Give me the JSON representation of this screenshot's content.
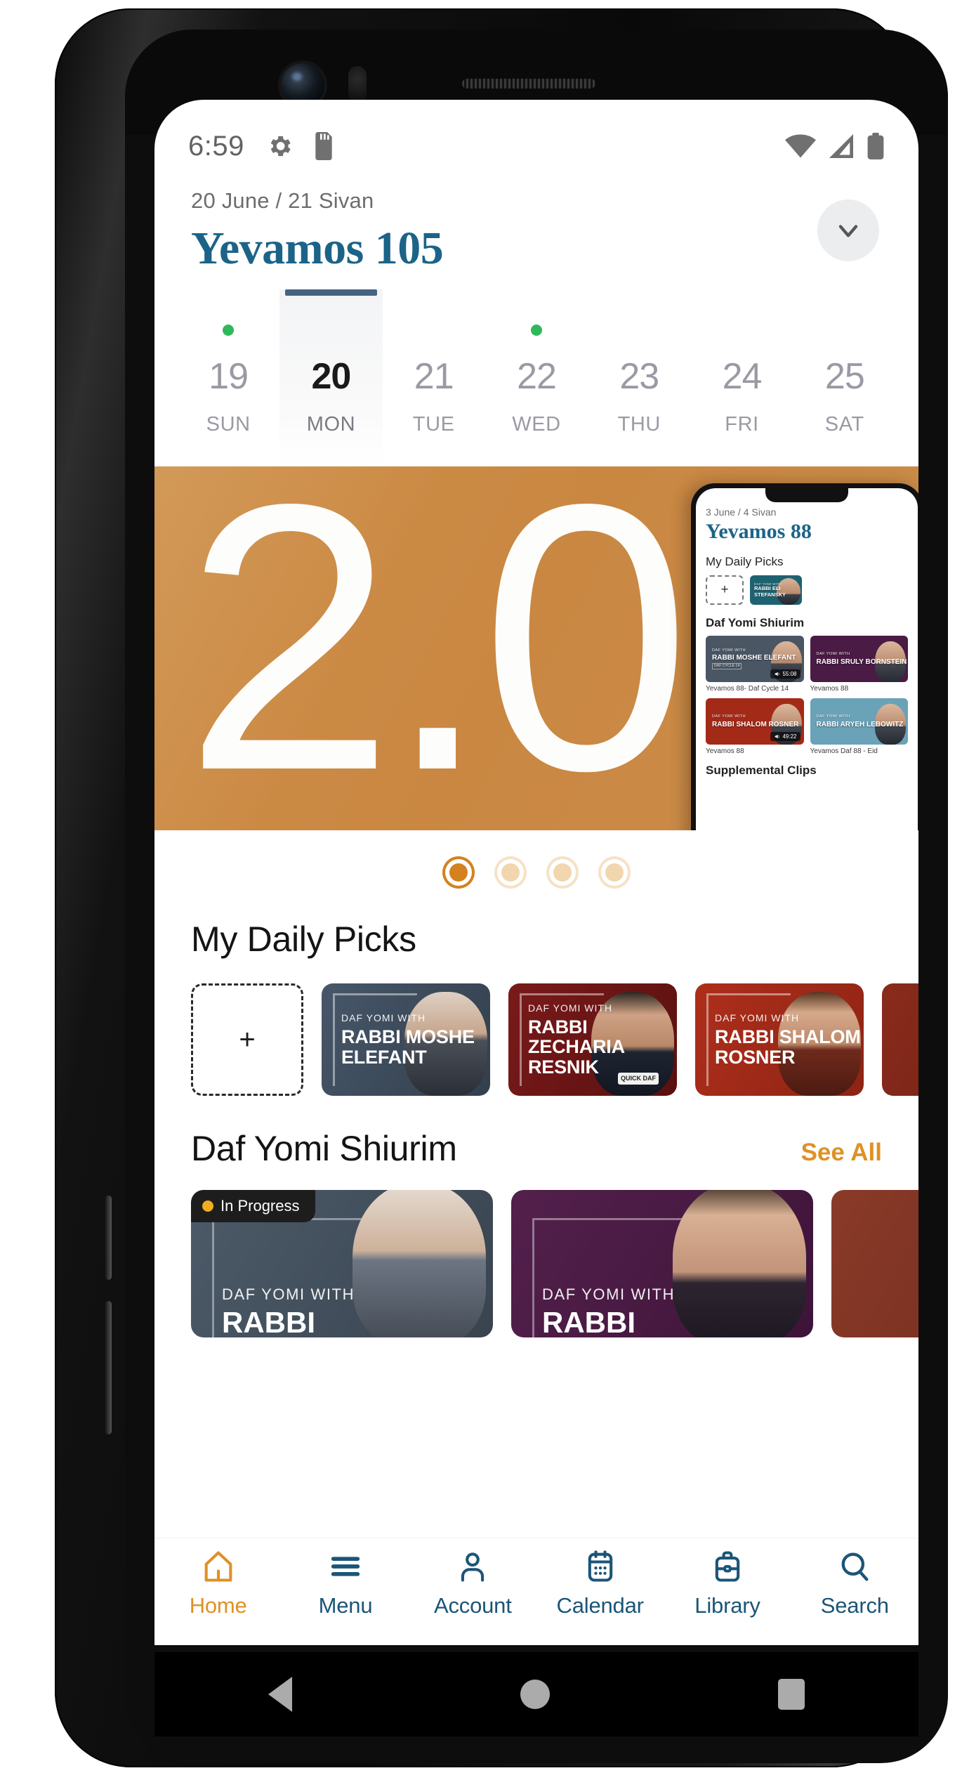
{
  "statusbar": {
    "time": "6:59",
    "left_icons": [
      "gear-icon",
      "sd-card-icon"
    ],
    "right_icons": [
      "wifi-icon",
      "cell-signal-icon",
      "battery-icon"
    ]
  },
  "header": {
    "date_line": "20 June / 21 Sivan",
    "title": "Yevamos 105",
    "expand_icon": "chevron-down-icon"
  },
  "date_strip": {
    "days": [
      {
        "num": "19",
        "name": "SUN",
        "selected": false,
        "dot": true
      },
      {
        "num": "20",
        "name": "MON",
        "selected": true,
        "dot": false
      },
      {
        "num": "21",
        "name": "TUE",
        "selected": false,
        "dot": false
      },
      {
        "num": "22",
        "name": "WED",
        "selected": false,
        "dot": true
      },
      {
        "num": "23",
        "name": "THU",
        "selected": false,
        "dot": false
      },
      {
        "num": "24",
        "name": "FRI",
        "selected": false,
        "dot": false
      },
      {
        "num": "25",
        "name": "SAT",
        "selected": false,
        "dot": false
      }
    ],
    "dot_color": "#2eb85c",
    "selected_bar_color": "#456382"
  },
  "promo": {
    "headline": "2.0",
    "background_color": "#cf9049",
    "inset_phone": {
      "date_line": "3 June / 4 Sivan",
      "title": "Yevamos 88",
      "picks_heading": "My Daily Picks",
      "picks": [
        {
          "label": "add",
          "glyph": "+"
        },
        {
          "prefix": "DAF YOMI WITH",
          "name": "RABBI ELI STEFANSKY",
          "color": "#1e6272"
        }
      ],
      "shiurim_heading": "Daf Yomi Shiurim",
      "shiurim": [
        {
          "prefix": "DAF YOMI WITH",
          "name": "RABBI MOSHE ELEFANT",
          "cycle": "DAF CYCLE 14",
          "duration": "55:08",
          "caption": "Yevamos 88- Daf Cycle 14",
          "color": "#4a5664"
        },
        {
          "prefix": "DAF YOMI WITH",
          "name": "RABBI SRULY BORNSTEIN",
          "cycle": "",
          "duration": "",
          "caption": "Yevamos 88",
          "color": "#4a1b44"
        },
        {
          "prefix": "DAF YOMI WITH",
          "name": "RABBI SHALOM ROSNER",
          "cycle": "",
          "duration": "49:22",
          "caption": "Yevamos 88",
          "color": "#a42a18"
        },
        {
          "prefix": "DAF YOMI WITH",
          "name": "RABBI ARYEH LEBOWITZ",
          "cycle": "",
          "duration": "",
          "caption": "Yevamos Daf 88 - Eid",
          "color": "#6aa2b8"
        }
      ],
      "supplemental_heading": "Supplemental Clips"
    }
  },
  "carousel": {
    "total": 4,
    "active_index": 0,
    "active_color": "#d4821f",
    "inactive_color": "#f3d9b5"
  },
  "daily_picks": {
    "heading": "My Daily Picks",
    "add_glyph": "+",
    "cards": [
      {
        "prefix": "DAF YOMI WITH",
        "name": "RABBI MOSHE ELEFANT",
        "color": "#3d4c5c",
        "badge": ""
      },
      {
        "prefix": "DAF YOMI WITH",
        "name": "RABBI ZECHARIA RESNIK",
        "color": "#6d1414",
        "badge": "QUICK DAF"
      },
      {
        "prefix": "DAF YOMI WITH",
        "name": "RABBI SHALOM ROSNER",
        "color": "#a42a18",
        "badge": ""
      },
      {
        "prefix": "",
        "name": "",
        "color": "#8a2b1c",
        "badge": ""
      }
    ]
  },
  "shiurim": {
    "heading": "Daf Yomi Shiurim",
    "see_all": "See All",
    "cards": [
      {
        "prefix": "DAF YOMI WITH",
        "name": "RABBI",
        "color": "#4a5664",
        "badge": "In Progress",
        "badge_dot_color": "#f0ad1e"
      },
      {
        "prefix": "DAF YOMI WITH",
        "name": "RABBI",
        "color": "#4a1b44",
        "badge": ""
      },
      {
        "prefix": "",
        "name": "",
        "color": "#8a3a28",
        "badge": ""
      }
    ]
  },
  "tabbar": {
    "items": [
      {
        "label": "Home",
        "icon": "home-icon",
        "active": true
      },
      {
        "label": "Menu",
        "icon": "hamburger-icon",
        "active": false
      },
      {
        "label": "Account",
        "icon": "person-icon",
        "active": false
      },
      {
        "label": "Calendar",
        "icon": "calendar-icon",
        "active": false
      },
      {
        "label": "Library",
        "icon": "briefcase-icon",
        "active": false
      },
      {
        "label": "Search",
        "icon": "search-icon",
        "active": false
      }
    ],
    "active_color": "#df9126",
    "inactive_color": "#1b5578"
  },
  "android_nav": {
    "back": "back-triangle-icon",
    "home": "home-circle-icon",
    "recents": "recents-square-icon"
  }
}
